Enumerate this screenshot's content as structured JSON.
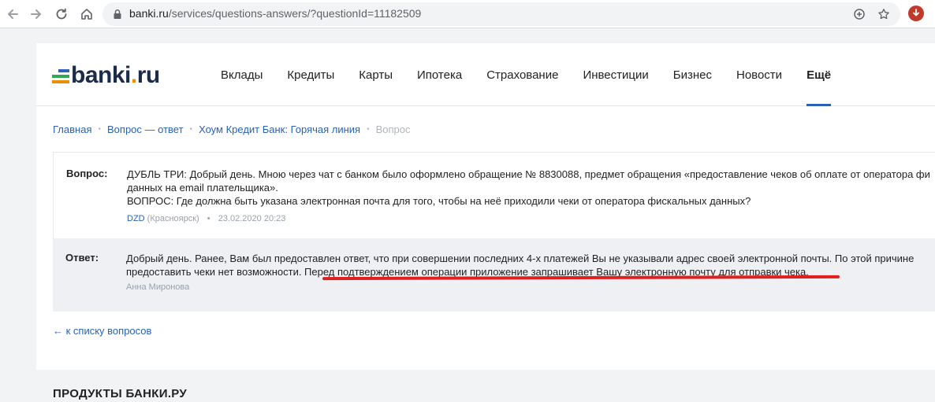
{
  "browser": {
    "url_host": "banki.ru",
    "url_path": "/services/questions-answers/?questionId=11182509"
  },
  "logo": {
    "part1": "banki",
    "dot": ".",
    "part2": "ru"
  },
  "menu": [
    {
      "label": "Вклады"
    },
    {
      "label": "Кредиты"
    },
    {
      "label": "Карты"
    },
    {
      "label": "Ипотека"
    },
    {
      "label": "Страхование"
    },
    {
      "label": "Инвестиции"
    },
    {
      "label": "Бизнес"
    },
    {
      "label": "Новости"
    },
    {
      "label": "Ещё"
    }
  ],
  "breadcrumb": {
    "home": "Главная",
    "qa": "Вопрос — ответ",
    "bank": "Хоум Кредит Банк: Горячая линия",
    "current": "Вопрос",
    "separator": "•"
  },
  "question": {
    "label": "Вопрос:",
    "line1": "ДУБЛЬ ТРИ: Добрый день. Мною через чат с банком было оформлено обращение № 8830088, предмет обращения «предоставление чеков об оплате от оператора фи",
    "line2": "данных на email плательщика».",
    "line3": "ВОПРОС: Где должна быть указана электронная почта для того, чтобы на неё приходили чеки от оператора фискальных данных?",
    "author": "DZD",
    "city": "(Красноярск)",
    "date": "23.02.2020 20:23",
    "separator": "•"
  },
  "answer": {
    "label": "Ответ:",
    "line1": "Добрый день. Ранее, Вам был предоставлен ответ, что при совершении последних 4-х платежей Вы не указывали адрес своей электронной почты. По этой причине",
    "line2": "предоставить чеки нет возможности. Перед подтверждением операции приложение запрашивает Вашу электронную почту для отправки чека.",
    "author": "Анна Миронова"
  },
  "back_link": "← к списку вопросов",
  "products_title": "ПРОДУКТЫ БАНКИ.РУ",
  "colors": {
    "link": "#2a62b5",
    "logo_text": "#1b2b4a",
    "logo_dot": "#f08c00",
    "underline": "#e0201e",
    "answer_bg": "#eef0f3"
  }
}
